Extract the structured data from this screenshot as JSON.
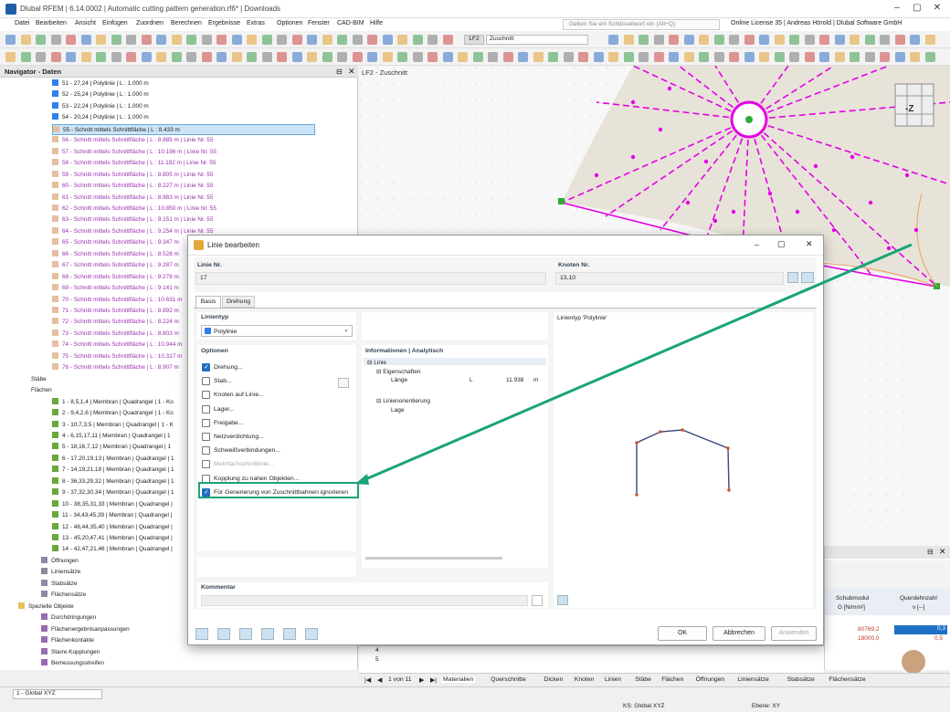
{
  "window": {
    "title": "Dlubal RFEM | 6.14.0002 | Automatic cutting pattern generation.rf6* | Downloads"
  },
  "menu": [
    "Datei",
    "Bearbeiten",
    "Ansicht",
    "Einfügen",
    "Zuordnen",
    "Berechnen",
    "Ergebnisse",
    "Extras",
    "Optionen",
    "Fenster",
    "CAD-BIM",
    "Hilfe"
  ],
  "search_placeholder": "Geben Sie ein Schlüsselwort ein (Alt+Q)",
  "license": "Online License 35 | Andreas Hörold | Dlubal Software GmbH",
  "toolbar": {
    "lf": "LF2",
    "lf_name": "Zuschnitt"
  },
  "navigator": {
    "title": "Navigator - Daten",
    "lines": [
      {
        "t": "51 - 27,24 | Polylinie | L : 1.000 m",
        "c": "#2f80ed",
        "cut": false
      },
      {
        "t": "52 - 25,24 | Polylinie | L : 1.000 m",
        "c": "#2f80ed",
        "cut": false
      },
      {
        "t": "53 - 22,24 | Polylinie | L : 1.000 m",
        "c": "#2f80ed",
        "cut": false
      },
      {
        "t": "54 - 20,24 | Polylinie | L : 1.000 m",
        "c": "#2f80ed",
        "cut": false
      },
      {
        "t": "55 - Schnitt mittels Schnittfläche | L : 8.433 m",
        "c": "#e6bfa0",
        "cut": false,
        "sel": true
      },
      {
        "t": "56 - Schnitt mittels Schnittfläche | L : 8.885 m | Linie Nr. 55",
        "c": "#e6bfa0",
        "cut": true
      },
      {
        "t": "57 - Schnitt mittels Schnittfläche | L : 10.196 m | Linie Nr. 55",
        "c": "#e6bfa0",
        "cut": true
      },
      {
        "t": "58 - Schnitt mittels Schnittfläche | L : 11.182 m | Linie Nr. 55",
        "c": "#e6bfa0",
        "cut": true
      },
      {
        "t": "59 - Schnitt mittels Schnittfläche | L : 8.805 m | Linie Nr. 55",
        "c": "#e6bfa0",
        "cut": true
      },
      {
        "t": "60 - Schnitt mittels Schnittfläche | L : 8.227 m | Linie Nr. 55",
        "c": "#e6bfa0",
        "cut": true
      },
      {
        "t": "61 - Schnitt mittels Schnittfläche | L : 8.883 m | Linie Nr. 55",
        "c": "#e6bfa0",
        "cut": true
      },
      {
        "t": "62 - Schnitt mittels Schnittfläche | L : 10.850 m | Linie Nr. 55",
        "c": "#e6bfa0",
        "cut": true
      },
      {
        "t": "63 - Schnitt mittels Schnittfläche | L : 9.151 m | Linie Nr. 55",
        "c": "#e6bfa0",
        "cut": true
      },
      {
        "t": "64 - Schnitt mittels Schnittfläche | L : 9.254 m | Linie Nr. 55",
        "c": "#e6bfa0",
        "cut": true
      },
      {
        "t": "65 - Schnitt mittels Schnittfläche | L : 9.347 m",
        "c": "#e6bfa0",
        "cut": true
      },
      {
        "t": "66 - Schnitt mittels Schnittfläche | L : 8.528 m",
        "c": "#e6bfa0",
        "cut": true
      },
      {
        "t": "67 - Schnitt mittels Schnittfläche | L : 9.287 m",
        "c": "#e6bfa0",
        "cut": true
      },
      {
        "t": "68 - Schnitt mittels Schnittfläche | L : 9.278 m",
        "c": "#e6bfa0",
        "cut": true
      },
      {
        "t": "69 - Schnitt mittels Schnittfläche | L : 9.141 m",
        "c": "#e6bfa0",
        "cut": true
      },
      {
        "t": "70 - Schnitt mittels Schnittfläche | L : 10.631 m",
        "c": "#e6bfa0",
        "cut": true
      },
      {
        "t": "71 - Schnitt mittels Schnittfläche | L : 8.892 m",
        "c": "#e6bfa0",
        "cut": true
      },
      {
        "t": "72 - Schnitt mittels Schnittfläche | L : 8.224 m",
        "c": "#e6bfa0",
        "cut": true
      },
      {
        "t": "73 - Schnitt mittels Schnittfläche | L : 8.803 m",
        "c": "#e6bfa0",
        "cut": true
      },
      {
        "t": "74 - Schnitt mittels Schnittfläche | L : 10.944 m",
        "c": "#e6bfa0",
        "cut": true
      },
      {
        "t": "75 - Schnitt mittels Schnittfläche | L : 10.317 m",
        "c": "#e6bfa0",
        "cut": true
      },
      {
        "t": "76 - Schnitt mittels Schnittfläche | L : 8.907 m",
        "c": "#e6bfa0",
        "cut": true
      }
    ],
    "staebe": "Stäbe",
    "flaechen": "Flächen",
    "surfaces": [
      "1 - 8,5,1,4 | Membran | Quadrangel | 1 - Ko",
      "2 - 9,4,2,6 | Membran | Quadrangel | 1 - Ko",
      "3 - 10,7,3,5 | Membran | Quadrangel | 1 - K",
      "4 - 6,15,17,11 | Membran | Quadrangel | 1",
      "5 - 18,16,7,12 | Membran | Quadrangel | 1",
      "6 - 17,20,19,13 | Membran | Quadrangel | 1",
      "7 - 14,19,21,18 | Membran | Quadrangel | 1",
      "8 - 36,33,29,32 | Membran | Quadrangel | 1",
      "9 - 37,32,30,34 | Membran | Quadrangel | 1",
      "10 - 38,35,31,33 | Membran | Quadrangel |",
      "11 - 34,43,45,39 | Membran | Quadrangel |",
      "12 - 46,44,35,40 | Membran | Quadrangel |",
      "13 - 45,20,47,41 | Membran | Quadrangel |",
      "14 - 42,47,21,46 | Membran | Quadrangel |"
    ],
    "tail": [
      "Öffnungen",
      "Liniensätze",
      "Stabsätze",
      "Flächensätze"
    ],
    "special": "Spezielle Objekte",
    "special_items": [
      "Durchdringungen",
      "Flächenergebnisanpassungen",
      "Flächenkontakte",
      "Starre Kopplungen",
      "Bemessungsstreifen"
    ]
  },
  "view": {
    "label": "LF2 - Zuschnitt",
    "cube": "-Z"
  },
  "dialog": {
    "title": "Linie bearbeiten",
    "linie_nr_label": "Linie Nr.",
    "linie_nr": "17",
    "knoten_nr_label": "Knoten Nr.",
    "knoten_nr": "13,10",
    "tabs": [
      "Basis",
      "Drehung"
    ],
    "linientyp_label": "Linientyp",
    "linientyp": "Polylinie",
    "optionen_label": "Optionen",
    "options": [
      {
        "t": "Drehung...",
        "on": true,
        "dis": false
      },
      {
        "t": "Stab...",
        "on": false,
        "dis": false
      },
      {
        "t": "Knoten auf Linie...",
        "on": false,
        "dis": false
      },
      {
        "t": "Lager...",
        "on": false,
        "dis": false
      },
      {
        "t": "Freigabe...",
        "on": false,
        "dis": false
      },
      {
        "t": "Netzverdichtung...",
        "on": false,
        "dis": false
      },
      {
        "t": "Schweißverbindungen...",
        "on": false,
        "dis": false
      },
      {
        "t": "Mehrfachschnittlinie...",
        "on": false,
        "dis": true
      },
      {
        "t": "Kopplung zu nahen Objekten...",
        "on": false,
        "dis": false
      },
      {
        "t": "Für Generierung von Zuschnittbahnen ignorieren",
        "on": true,
        "dis": false
      }
    ],
    "info_label": "Informationen | Analytisch",
    "info": {
      "linie": "Linie",
      "eig": "Eigenschaften",
      "laenge": "Länge",
      "L": "L",
      "laenge_val": "11.938",
      "m": "m",
      "orient": "Linienorientierung",
      "lage": "Lage"
    },
    "preview_label": "Linientyp 'Polylinie'",
    "kommentar": "Kommentar",
    "ok": "OK",
    "abbrechen": "Abbrechen",
    "anwenden": "Anwenden"
  },
  "table": {
    "h1": "Schubmodul",
    "h1b": "G [N/mm²]",
    "h2": "Querdehnzahl",
    "h2b": "v [--]",
    "r1a": "80769,2",
    "r1b": "0,3",
    "r2a": "18000,0",
    "r2b": "0,5",
    "rows": [
      "4",
      "5"
    ]
  },
  "pager": {
    "text": "1 von 11"
  },
  "bottom_tabs": [
    "Materialien",
    "Querschnitte",
    "Dicken",
    "Knoten",
    "Linien",
    "Stäbe",
    "Flächen",
    "Öffnungen",
    "Liniensätze",
    "Stabsätze",
    "Flächensätze"
  ],
  "status": {
    "cs": "1 - Global XYZ",
    "ks": "KS: Global XYZ",
    "ebene": "Ebene: XY"
  },
  "colors": {
    "accent": "#1f6fc5",
    "highlight": "#1aa37a",
    "magenta": "#e400e4"
  }
}
